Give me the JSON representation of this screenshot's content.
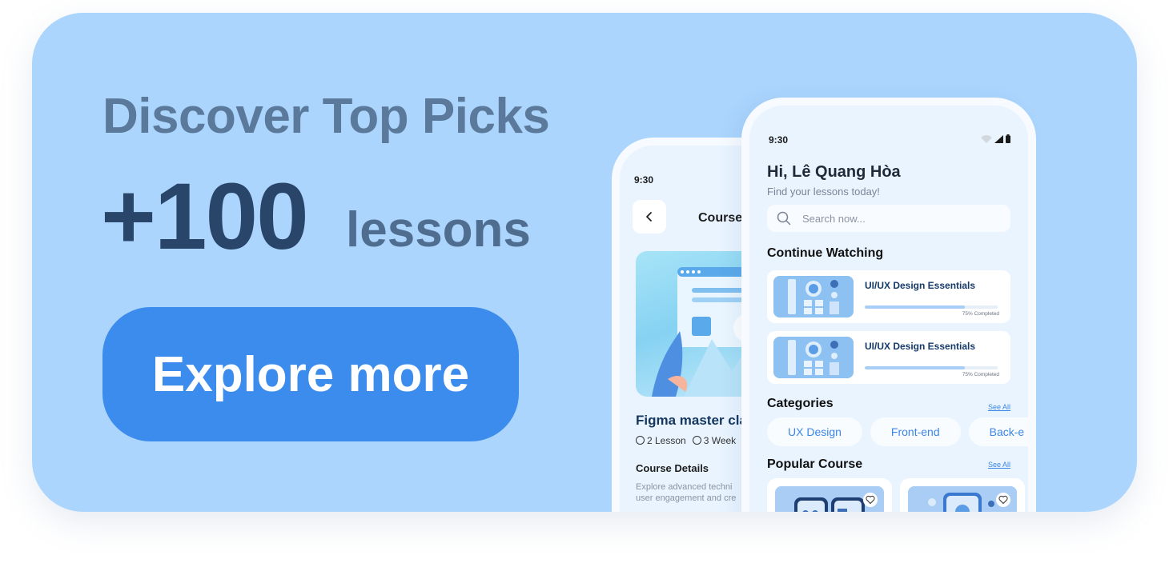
{
  "banner": {
    "headline": "Discover Top Picks",
    "count": "+100",
    "unit": "lessons",
    "cta_label": "Explore more"
  },
  "back_phone": {
    "time": "9:30",
    "header_title": "Course",
    "course_title": "Figma master cla",
    "lessons": "2 Lesson",
    "duration": "3 Week",
    "details_heading": "Course Details",
    "details_line1": "Explore advanced techni",
    "details_line2": "user engagement and cre"
  },
  "front_phone": {
    "time": "9:30",
    "greeting": "Hi, Lê Quang Hòa",
    "subtitle": "Find your lessons today!",
    "search_placeholder": "Search now...",
    "continue_heading": "Continue Watching",
    "continue_items": [
      {
        "title": "UI/UX Design Essentials",
        "progress": 0.75,
        "progress_label": "75% Completed"
      },
      {
        "title": "UI/UX Design Essentials",
        "progress": 0.75,
        "progress_label": "75% Completed"
      }
    ],
    "categories_heading": "Categories",
    "categories_see_all": "See All",
    "categories": [
      "UX Design",
      "Front-end",
      "Back-e"
    ],
    "popular_heading": "Popular Course",
    "popular_see_all": "See All"
  },
  "colors": {
    "banner_bg": "#abd5fd",
    "cta_bg": "#3b8ced",
    "accent": "#3b86e6",
    "headline": "#5b7a9b",
    "count": "#29466a"
  }
}
